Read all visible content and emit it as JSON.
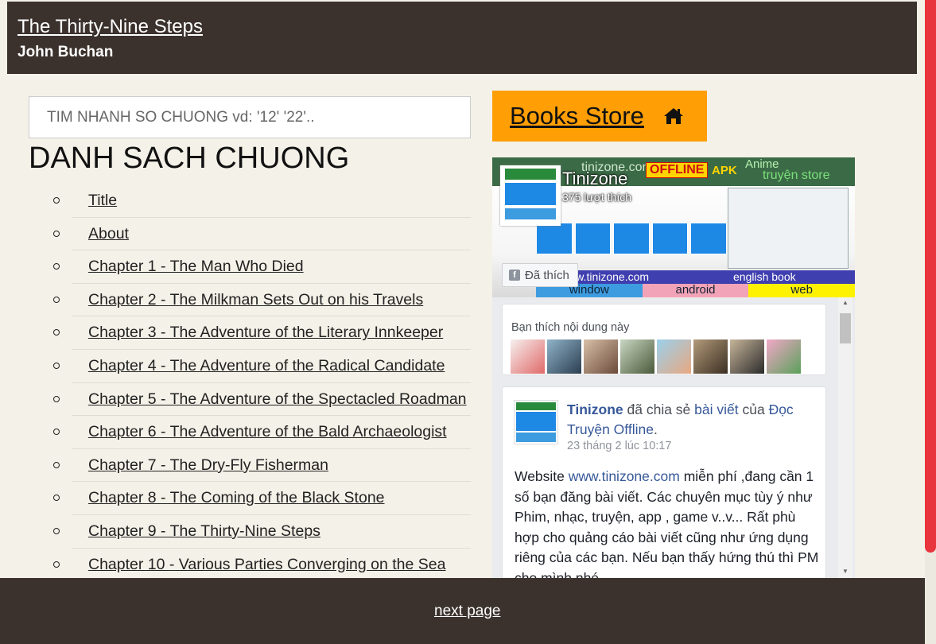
{
  "header": {
    "title": "The Thirty-Nine Steps",
    "author": "John Buchan"
  },
  "search": {
    "placeholder": "TIM NHANH SO CHUONG vd: '12' '22'.."
  },
  "chapter_list": {
    "heading": "DANH SACH CHUONG",
    "items": [
      "Title",
      "About",
      "Chapter 1 - The Man Who Died",
      "Chapter 2 - The Milkman Sets Out on his Travels",
      "Chapter 3 - The Adventure of the Literary Innkeeper",
      "Chapter 4 - The Adventure of the Radical Candidate",
      "Chapter 5 - The Adventure of the Spectacled Roadman",
      "Chapter 6 - The Adventure of the Bald Archaeologist",
      "Chapter 7 - The Dry-Fly Fisherman",
      "Chapter 8 - The Coming of the Black Stone",
      "Chapter 9 - The Thirty-Nine Steps",
      "Chapter 10 - Various Parties Converging on the Sea"
    ]
  },
  "books_store": {
    "label": "Books Store",
    "icon": "home-icon",
    "color": "#ff9e05"
  },
  "facebook": {
    "cover": {
      "site": "tinizone.com",
      "offline": "OFFLINE",
      "apk": "APK",
      "anime": "Anime",
      "truyen": "truyện store",
      "url": "www.tinizone.com",
      "english": "english book",
      "window": "window",
      "android": "android",
      "web": "web"
    },
    "page_name": "Tinizone",
    "likes": "375 lượt thích",
    "like_button": "Đã thích",
    "friends_text": "Bạn thích nội dung này",
    "post": {
      "author": "Tinizone",
      "action": " đã chia sẻ ",
      "link": "bài viết",
      "of": " của ",
      "target": "Đọc Truyện Offline",
      "dot": ".",
      "time": "23 tháng 2 lúc 10:17",
      "body_prefix": "Website ",
      "body_link": "www.tinizone.com",
      "body_rest": " miễn phí ,đang cần 1 số bạn đăng bài viết. Các chuyên mục tùy ý như Phim, nhạc, truyện, app , game v..v... Rất phù hợp cho quảng cáo bài viết cũng như ứng dụng riêng của các bạn. Nếu bạn thấy hứng thú thì PM cho mình nhé."
    }
  },
  "footer": {
    "next_label": "next page"
  },
  "colors": {
    "header_bg": "#3b322d",
    "page_bg": "#f4f1e8",
    "scrollbar": "#e8343c",
    "fb_link": "#365899"
  }
}
